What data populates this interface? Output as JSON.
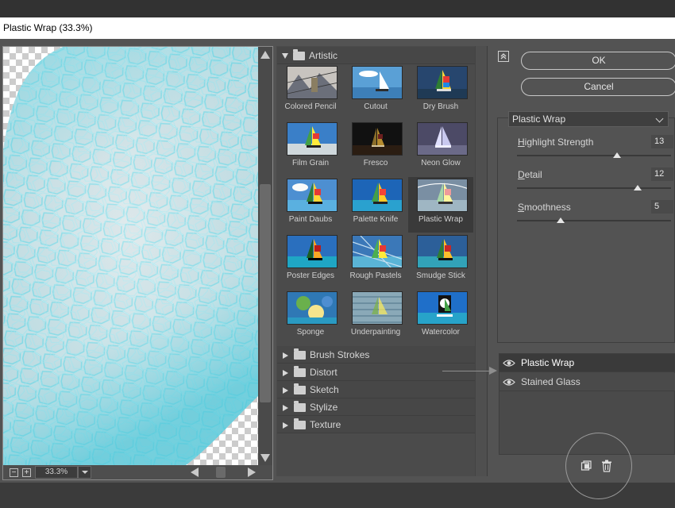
{
  "window": {
    "title": "Plastic Wrap (33.3%)"
  },
  "preview": {
    "zoom": "33.3%",
    "zoom_in_symbol": "+",
    "zoom_out_symbol": "−"
  },
  "gallery": {
    "open_category": "Artistic",
    "filters": [
      {
        "label": "Colored Pencil",
        "selected": false
      },
      {
        "label": "Cutout",
        "selected": false
      },
      {
        "label": "Dry Brush",
        "selected": false
      },
      {
        "label": "Film Grain",
        "selected": false
      },
      {
        "label": "Fresco",
        "selected": false
      },
      {
        "label": "Neon Glow",
        "selected": false
      },
      {
        "label": "Paint Daubs",
        "selected": false
      },
      {
        "label": "Palette Knife",
        "selected": false
      },
      {
        "label": "Plastic Wrap",
        "selected": true
      },
      {
        "label": "Poster Edges",
        "selected": false
      },
      {
        "label": "Rough Pastels",
        "selected": false
      },
      {
        "label": "Smudge Stick",
        "selected": false
      },
      {
        "label": "Sponge",
        "selected": false
      },
      {
        "label": "Underpainting",
        "selected": false
      },
      {
        "label": "Watercolor",
        "selected": false
      }
    ],
    "closed_categories": [
      "Brush Strokes",
      "Distort",
      "Sketch",
      "Stylize",
      "Texture"
    ]
  },
  "buttons": {
    "ok": "OK",
    "cancel": "Cancel"
  },
  "settings": {
    "filter_select": "Plastic Wrap",
    "params": [
      {
        "label_underline": "H",
        "label_rest": "ighlight Strength",
        "value": "13",
        "min": 0,
        "max": 20,
        "fraction": 0.65
      },
      {
        "label_underline": "D",
        "label_rest": "etail",
        "value": "12",
        "min": 1,
        "max": 15,
        "fraction": 0.786
      },
      {
        "label_underline": "S",
        "label_rest": "moothness",
        "value": "5",
        "min": 1,
        "max": 15,
        "fraction": 0.286
      }
    ]
  },
  "layers": [
    {
      "name": "Plastic Wrap",
      "active": true
    },
    {
      "name": "Stained Glass",
      "active": false
    }
  ],
  "colors": {
    "accent_cyan": "#5fd3e3",
    "panel": "#535353",
    "dark": "#323232"
  }
}
